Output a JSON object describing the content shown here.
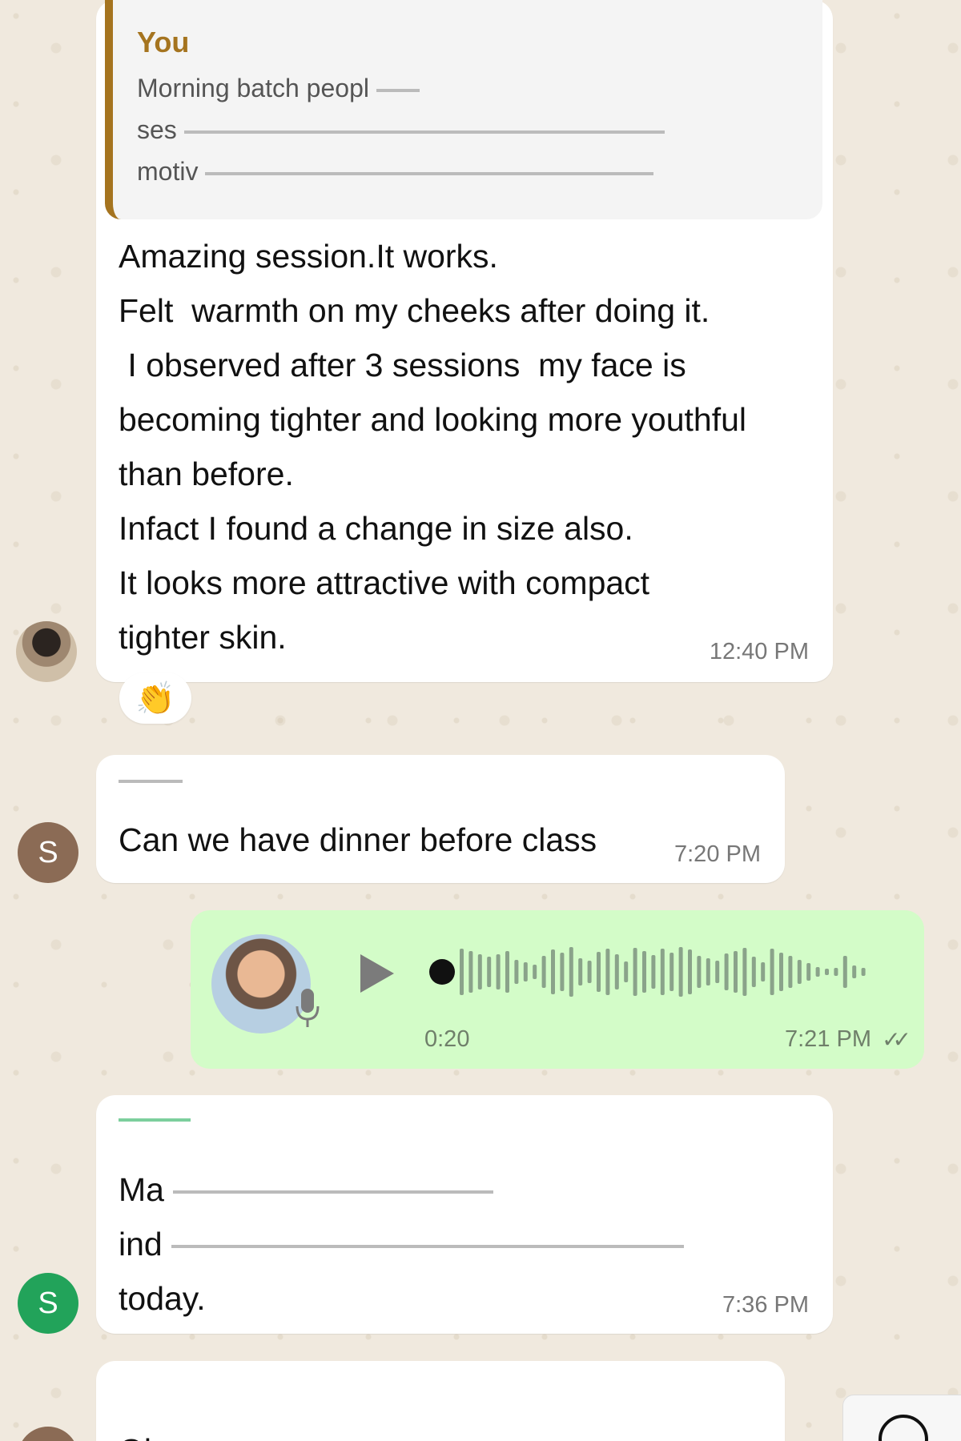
{
  "messages": [
    {
      "quote": {
        "author": "You",
        "lines": [
          "Morning batch peopl",
          "ses",
          "motiv"
        ]
      },
      "text_lines": [
        "Amazing session.It works.",
        "Felt  warmth on my cheeks after doing it.",
        " I observed after 3 sessions  my face is",
        "becoming tighter and looking more youthful",
        "than before.",
        "Infact I found a change in size also.",
        "It looks more attractive with compact",
        "tighter skin."
      ],
      "time": "12:40 PM",
      "reaction": "👏"
    },
    {
      "avatar_letter": "S",
      "avatar_color": "#8b6b55",
      "text": "Can we have dinner before class",
      "time": "7:20 PM"
    },
    {
      "voice": {
        "duration": "0:20",
        "time": "7:21 PM",
        "ticks": "✓✓"
      }
    },
    {
      "avatar_letter": "S",
      "avatar_color": "#22a35a",
      "text_lines": [
        "Ma",
        "ind",
        "today."
      ],
      "time": "7:36 PM"
    },
    {
      "text": "Ok"
    }
  ],
  "icons": {
    "play": "play-icon",
    "mic": "microphone-icon",
    "scroll_down": "chevron-down-icon"
  }
}
